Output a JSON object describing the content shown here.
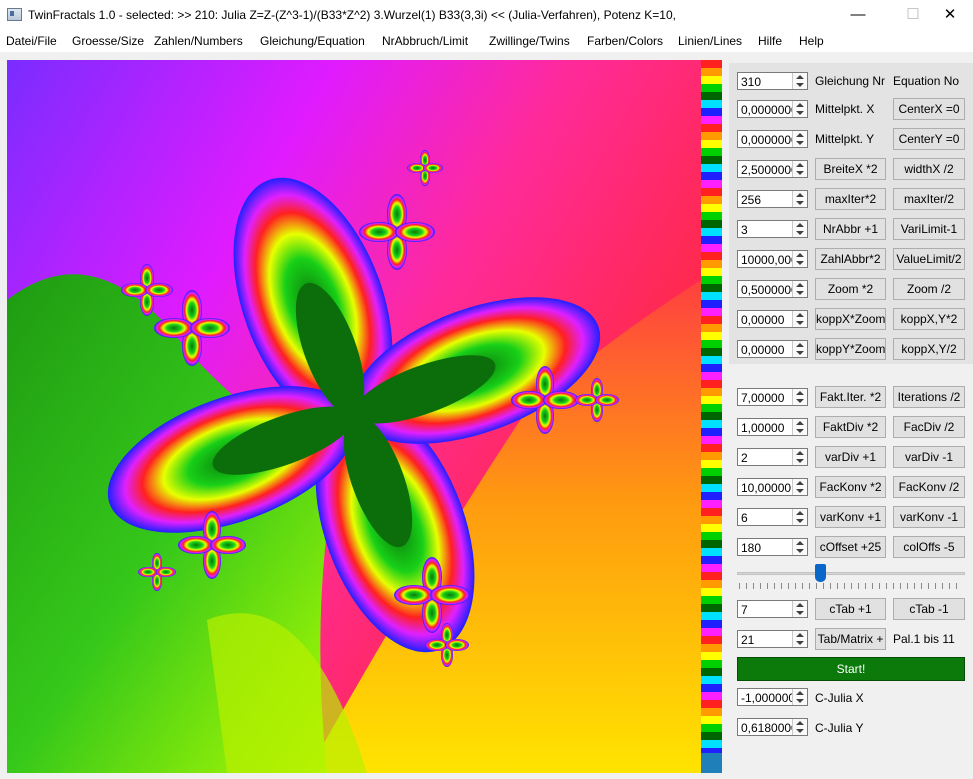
{
  "window": {
    "title": "TwinFractals 1.0 - selected: >> 210: Julia Z=Z-(Z^3-1)/(B33*Z^2) 3.Wurzel(1) B33(3,3i) << (Julia-Verfahren), Potenz K=10,",
    "minimize": "—",
    "maximize": "☐",
    "close": "✕"
  },
  "menu": [
    "Datei/File",
    "Groesse/Size",
    "Zahlen/Numbers",
    "Gleichung/Equation",
    "NrAbbruch/Limit",
    "Zwillinge/Twins",
    "Farben/Colors",
    "Linien/Lines",
    "Hilfe",
    "Help"
  ],
  "top_rows": [
    {
      "value": "310",
      "label_mid": "Gleichung Nr",
      "label_right": "Equation No"
    },
    {
      "value": "0,0000000",
      "label_mid": "Mittelpkt. X",
      "button_right": "CenterX =0"
    },
    {
      "value": "0,0000000",
      "label_mid": "Mittelpkt. Y",
      "button_right": "CenterY =0"
    },
    {
      "value": "2,5000000",
      "button_mid": "BreiteX *2",
      "button_right": "widthX /2"
    },
    {
      "value": "256",
      "button_mid": "maxIter*2",
      "button_right": "maxIter/2"
    },
    {
      "value": "3",
      "button_mid": "NrAbbr +1",
      "button_right": "VariLimit-1"
    },
    {
      "value": "10000,000",
      "button_mid": "ZahlAbbr*2",
      "button_right": "ValueLimit/2"
    },
    {
      "value": "0,5000000",
      "button_mid": "Zoom *2",
      "button_right": "Zoom /2"
    },
    {
      "value": "0,00000",
      "button_mid": "koppX*Zoom",
      "button_right": "koppX,Y*2"
    },
    {
      "value": "0,00000",
      "button_mid": "koppY*Zoom",
      "button_right": "koppX,Y/2"
    }
  ],
  "bottom_rows": [
    {
      "value": "7,00000",
      "button_mid": "Fakt.Iter. *2",
      "button_right": "Iterations /2"
    },
    {
      "value": "1,00000",
      "button_mid": "FaktDiv *2",
      "button_right": "FacDiv /2"
    },
    {
      "value": "2",
      "button_mid": "varDiv +1",
      "button_right": "varDiv -1"
    },
    {
      "value": "10,00000",
      "button_mid": "FacKonv *2",
      "button_right": "FacKonv /2"
    },
    {
      "value": "6",
      "button_mid": "varKonv +1",
      "button_right": "varKonv -1"
    },
    {
      "value": "180",
      "button_mid": "cOffset +25",
      "button_right": "colOffs -5"
    }
  ],
  "slider": {
    "fraction": 0.36
  },
  "ctab": {
    "value": "7",
    "button_mid": "cTab +1",
    "button_right": "cTab -1"
  },
  "palette": {
    "value": "21",
    "button_mid": "Tab/Matrix +",
    "label_right": "Pal.1 bis 11"
  },
  "start_label": "Start!",
  "c_julia_x": {
    "value": "-1,0000000",
    "label": "C-Julia X"
  },
  "c_julia_y": {
    "value": "0,6180000",
    "label": "C-Julia Y"
  },
  "colors": {
    "start_green": "#0b7a0b",
    "slider_blue": "#0a66c9"
  }
}
